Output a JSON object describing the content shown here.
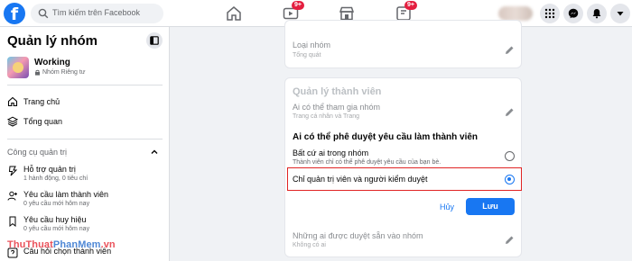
{
  "header": {
    "logo": "f",
    "search_placeholder": "Tìm kiếm trên Facebook",
    "nav": [
      {
        "icon": "home-icon",
        "badge": ""
      },
      {
        "icon": "watch-icon",
        "badge": "9+"
      },
      {
        "icon": "marketplace-icon",
        "badge": ""
      },
      {
        "icon": "groups-icon",
        "badge": "9+"
      }
    ],
    "right_icons": [
      "menu-grid-icon",
      "messenger-icon",
      "notifications-icon",
      "account-dropdown-icon"
    ]
  },
  "sidebar": {
    "title": "Quản lý nhóm",
    "group_name": "Working",
    "group_privacy": "Nhóm Riêng tư",
    "items": [
      {
        "label": "Trang chủ",
        "icon": "home-icon"
      },
      {
        "label": "Tổng quan",
        "icon": "overview-icon"
      }
    ],
    "section_title": "Công cụ quản trị",
    "tools": [
      {
        "label": "Hỗ trợ quản trị",
        "sub": "1 hành động, 0 tiêu chí",
        "icon": "admin-assist-icon"
      },
      {
        "label": "Yêu cầu làm thành viên",
        "sub": "0 yêu cầu mới hôm nay",
        "icon": "member-request-icon"
      },
      {
        "label": "Yêu cầu huy hiệu",
        "sub": "0 yêu cầu mới hôm nay",
        "icon": "badge-request-icon"
      },
      {
        "label": "Câu hỏi chọn thành viên",
        "sub": "",
        "icon": "question-icon"
      }
    ]
  },
  "main": {
    "group_type": {
      "label": "Loại nhóm",
      "value": "Tổng quát"
    },
    "member_section": {
      "title": "Quản lý thành viên",
      "who_can_join": {
        "label": "Ai có thể tham gia nhóm",
        "value": "Trang cá nhân và Trang"
      },
      "question": "Ai có thể phê duyệt yêu cầu làm thành viên",
      "options": [
        {
          "label": "Bất cứ ai trong nhóm",
          "sub": "Thành viên chỉ có thể phê duyệt yêu cầu của bạn bè.",
          "selected": false
        },
        {
          "label": "Chỉ quản trị viên và người kiểm duyệt",
          "sub": "",
          "selected": true
        }
      ],
      "cancel_label": "Hủy",
      "save_label": "Lưu",
      "preapproved": {
        "label": "Những ai được duyệt sẵn vào nhóm",
        "value": "Không có ai"
      }
    }
  },
  "watermark": {
    "part1": "ThuThuat",
    "part2": "PhanMem",
    "part3": ".vn"
  },
  "colors": {
    "accent": "#1877f2",
    "highlight": "#e02424",
    "badge": "#e41e3f"
  }
}
